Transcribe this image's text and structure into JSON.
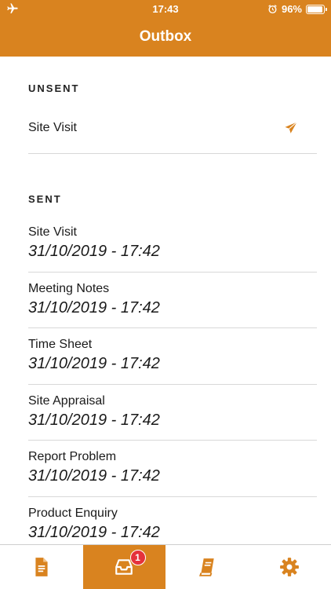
{
  "status_bar": {
    "time": "17:43",
    "battery": "96%",
    "battery_level": 0.96
  },
  "header": {
    "title": "Outbox"
  },
  "unsent": {
    "heading": "UNSENT",
    "items": [
      {
        "title": "Site Visit"
      }
    ]
  },
  "sent": {
    "heading": "SENT",
    "items": [
      {
        "title": "Site Visit",
        "date": "31/10/2019 - 17:42"
      },
      {
        "title": "Meeting Notes",
        "date": "31/10/2019 - 17:42"
      },
      {
        "title": "Time Sheet",
        "date": "31/10/2019 - 17:42"
      },
      {
        "title": "Site Appraisal",
        "date": "31/10/2019 - 17:42"
      },
      {
        "title": "Report Problem",
        "date": "31/10/2019 - 17:42"
      },
      {
        "title": "Product Enquiry",
        "date": "31/10/2019 - 17:42"
      }
    ]
  },
  "tabbar": {
    "tabs": [
      {
        "icon": "document-icon",
        "active": false
      },
      {
        "icon": "inbox-tray-icon",
        "active": true,
        "badge": "1"
      },
      {
        "icon": "book-icon",
        "active": false
      },
      {
        "icon": "gear-icon",
        "active": false
      }
    ]
  },
  "colors": {
    "accent": "#d9831f",
    "badge": "#e5323b",
    "divider": "#d8d8d8"
  }
}
